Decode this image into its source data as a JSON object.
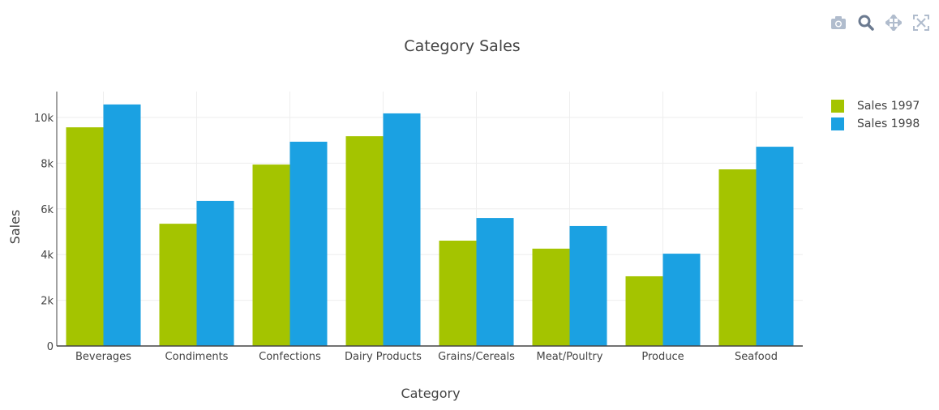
{
  "modebar": {
    "buttons": [
      {
        "name": "camera-icon",
        "title": "Download plot as a png"
      },
      {
        "name": "zoom-icon",
        "title": "Zoom"
      },
      {
        "name": "pan-icon",
        "title": "Pan"
      },
      {
        "name": "autoscale-icon",
        "title": "Reset axes"
      }
    ]
  },
  "colors": {
    "sales_1997": "#a4c400",
    "sales_1998": "#1ba1e2"
  },
  "chart_data": {
    "type": "bar",
    "title": "Category Sales",
    "xlabel": "Category",
    "ylabel": "Sales",
    "categories": [
      "Beverages",
      "Condiments",
      "Confections",
      "Dairy Products",
      "Grains/Cereals",
      "Meat/Poultry",
      "Produce",
      "Seafood"
    ],
    "series": [
      {
        "name": "Sales 1997",
        "values": [
          9570,
          5350,
          7940,
          9180,
          4610,
          4260,
          3050,
          7730
        ]
      },
      {
        "name": "Sales 1998",
        "values": [
          10570,
          6350,
          8940,
          10180,
          5600,
          5250,
          4040,
          8720
        ]
      }
    ],
    "ylim": [
      0,
      11000
    ],
    "yticks": [
      0,
      2000,
      4000,
      6000,
      8000,
      10000
    ],
    "ytick_labels": [
      "0",
      "2k",
      "4k",
      "6k",
      "8k",
      "10k"
    ],
    "grid": true,
    "legend": "top-right"
  }
}
